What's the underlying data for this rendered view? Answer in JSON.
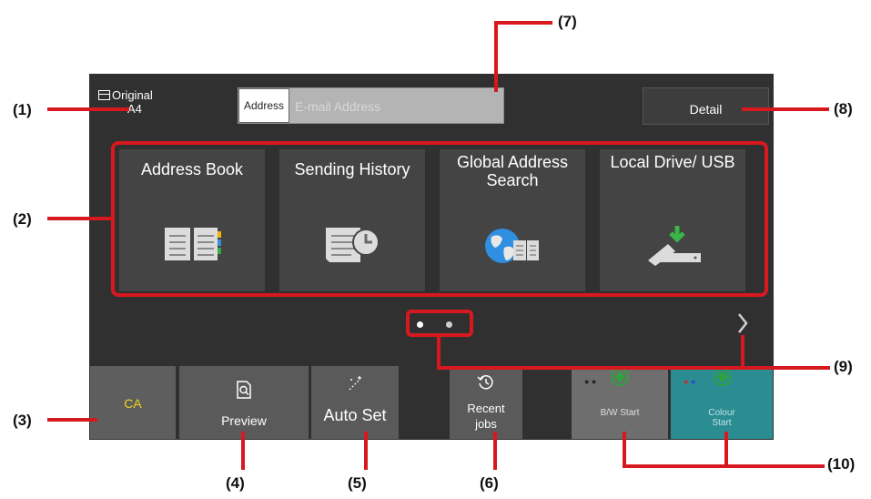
{
  "callouts": {
    "c1": "(1)",
    "c2": "(2)",
    "c3": "(3)",
    "c4": "(4)",
    "c5": "(5)",
    "c6": "(6)",
    "c7": "(7)",
    "c8": "(8)",
    "c9": "(9)",
    "c10": "(10)"
  },
  "original": {
    "label": "Original",
    "size": "A4"
  },
  "address": {
    "label": "Address",
    "placeholder": "E-mail Address",
    "value": ""
  },
  "detail_label": "Detail",
  "shortcuts": [
    {
      "label": "Address Book",
      "icon": "address-book-icon"
    },
    {
      "label": "Sending History",
      "icon": "sending-history-icon"
    },
    {
      "label": "Global Address Search",
      "icon": "global-address-search-icon"
    },
    {
      "label": "Local Drive/ USB",
      "icon": "usb-icon"
    }
  ],
  "page_indicator": {
    "pages": 2,
    "current": 1
  },
  "bottom": {
    "ca": "CA",
    "preview": "Preview",
    "auto_set": "Auto Set",
    "recent_jobs": "Recent jobs",
    "bw_start": "B/W Start",
    "colour_start": "Colour Start"
  },
  "colors": {
    "callout_line": "#d7191f",
    "ca_text": "#f2d21b",
    "colour_start": "#2b8c92",
    "start_icon": "#30a040"
  }
}
